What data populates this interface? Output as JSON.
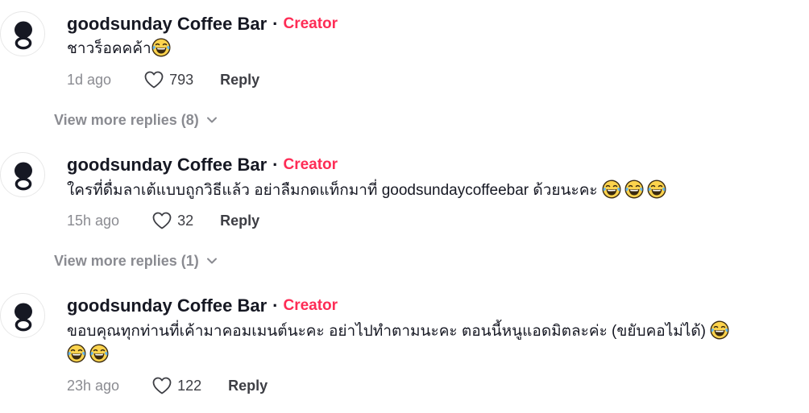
{
  "icons": {
    "avatar": "goodsunday-logo-icon",
    "like": "heart-outline-icon",
    "emoji": "tears-of-joy-emoji-icon",
    "chevron": "chevron-down-icon"
  },
  "colors": {
    "creator": "#fe2c55",
    "text": "#161823",
    "muted": "#8a8b91"
  },
  "comments": [
    {
      "username": "goodsunday Coffee Bar",
      "separator": "·",
      "badge": "Creator",
      "text": "ชาวร็อคคค้า",
      "emoji_count": 1,
      "time": "1d ago",
      "likes": "793",
      "reply_label": "Reply",
      "view_more": "View more replies (8)"
    },
    {
      "username": "goodsunday Coffee Bar",
      "separator": "·",
      "badge": "Creator",
      "text": "ใครที่ดื่มลาเต้แบบถูกวิธีแล้ว อย่าลืมกดแท็กมาที่ goodsundaycoffeebar ด้วยนะคะ",
      "emoji_count": 3,
      "time": "15h ago",
      "likes": "32",
      "reply_label": "Reply",
      "view_more": "View more replies (1)"
    },
    {
      "username": "goodsunday Coffee Bar",
      "separator": "·",
      "badge": "Creator",
      "text": "ขอบคุณทุกท่านที่เค้ามาคอมเมนต์นะคะ อย่าไปทำตามนะคะ ตอนนี้หนูแอดมิตละค่ะ (ขยับคอไม่ได้)",
      "emoji_count": 3,
      "time": "23h ago",
      "likes": "122",
      "reply_label": "Reply"
    }
  ]
}
